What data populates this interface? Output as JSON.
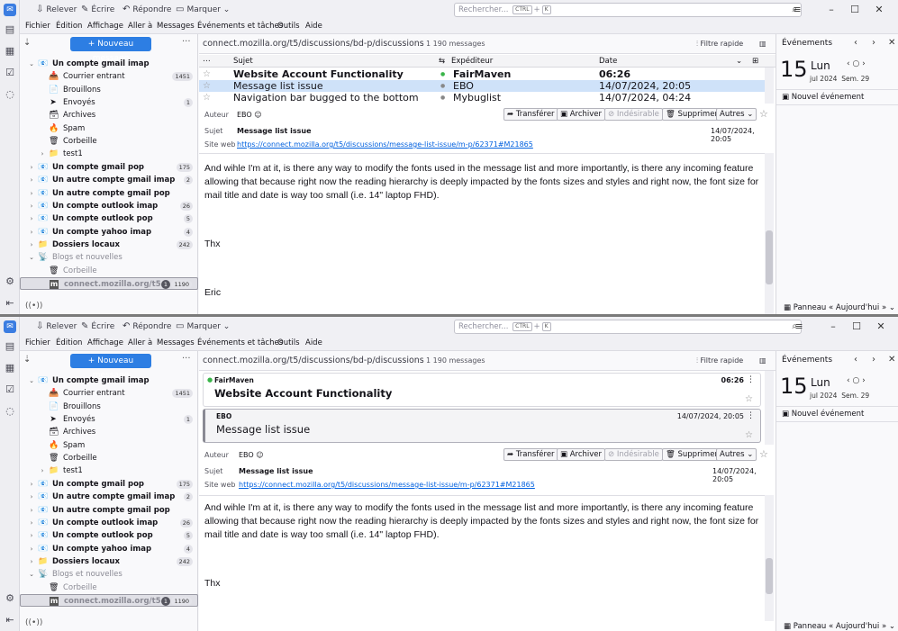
{
  "toolbar": {
    "get_mail": "Relever",
    "write": "Écrire",
    "reply": "Répondre",
    "tag": "Marquer",
    "search_placeholder": "Rechercher...",
    "kbd1": "CTRL",
    "kbd_plus": "+",
    "kbd2": "K"
  },
  "menu": [
    "Fichier",
    "Édition",
    "Affichage",
    "Aller à",
    "Messages",
    "Événements et tâches",
    "Outils",
    "Aide"
  ],
  "folders": {
    "new_message": "+ Nouveau message",
    "items": [
      {
        "label": "Un compte gmail imap",
        "bold": true,
        "level": 0,
        "icon": "📧",
        "badge": ""
      },
      {
        "label": "Courrier entrant",
        "bold": false,
        "level": 1,
        "icon": "📥",
        "badge": "1451"
      },
      {
        "label": "Brouillons",
        "bold": false,
        "level": 1,
        "icon": "📄",
        "badge": ""
      },
      {
        "label": "Envoyés",
        "bold": false,
        "level": 1,
        "icon": "➤",
        "badge": "1"
      },
      {
        "label": "Archives",
        "bold": false,
        "level": 1,
        "icon": "🗃",
        "badge": ""
      },
      {
        "label": "Spam",
        "bold": false,
        "level": 1,
        "icon": "🔥",
        "badge": ""
      },
      {
        "label": "Corbeille",
        "bold": false,
        "level": 1,
        "icon": "🗑",
        "badge": ""
      },
      {
        "label": "test1",
        "bold": false,
        "level": 1,
        "icon": "📁",
        "badge": ""
      },
      {
        "label": "Un compte gmail pop",
        "bold": true,
        "level": 0,
        "icon": "📧",
        "badge": "175"
      },
      {
        "label": "Un autre compte gmail imap",
        "bold": true,
        "level": 0,
        "icon": "📧",
        "badge": "2"
      },
      {
        "label": "Un autre compte gmail pop",
        "bold": true,
        "level": 0,
        "icon": "📧",
        "badge": ""
      },
      {
        "label": "Un compte outlook imap",
        "bold": true,
        "level": 0,
        "icon": "📧",
        "badge": "26"
      },
      {
        "label": "Un compte outlook pop",
        "bold": true,
        "level": 0,
        "icon": "📧",
        "badge": "5"
      },
      {
        "label": "Un compte yahoo imap",
        "bold": true,
        "level": 0,
        "icon": "📧",
        "badge": "4"
      },
      {
        "label": "Dossiers locaux",
        "bold": true,
        "level": 0,
        "icon": "📁",
        "badge": "242"
      },
      {
        "label": "Blogs et nouvelles",
        "bold": false,
        "level": 0,
        "icon": "📡",
        "badge": "",
        "grey": true
      },
      {
        "label": "Corbeille",
        "bold": false,
        "level": 1,
        "icon": "🗑",
        "badge": "",
        "grey": true
      },
      {
        "label": "connect.mozilla.org/t5...",
        "bold": true,
        "level": 1,
        "icon": "m",
        "badge": "1190",
        "unread": "1",
        "selected": true,
        "grey": true
      }
    ]
  },
  "list": {
    "path": "connect.mozilla.org/t5/discussions/bd-p/discussions",
    "count": "1 190 messages",
    "quick_filter": "Filtre rapide",
    "col_subject": "Sujet",
    "col_sender": "Expéditeur",
    "col_date": "Date",
    "rows": [
      {
        "subject": "Website Account Functionality",
        "sender": "FairMaven",
        "date": "06:26",
        "bold": true
      },
      {
        "subject": "Message list issue",
        "sender": "EBO",
        "date": "14/07/2024, 20:05",
        "bold": false,
        "selected": true
      },
      {
        "subject": "Navigation bar bugged to the bottom",
        "sender": "Mybuglist",
        "date": "14/07/2024, 04:24",
        "bold": false
      }
    ]
  },
  "header": {
    "author_label": "Auteur",
    "author": "EBO",
    "subject_label": "Sujet",
    "subject": "Message list issue",
    "site_label": "Site web",
    "site": "https://connect.mozilla.org/t5/discussions/message-list-issue/m-p/62371#M21865",
    "date": "14/07/2024, 20:05",
    "forward": "Transférer",
    "archive": "Archiver",
    "junk": "Indésirable",
    "delete": "Supprimer",
    "other": "Autres"
  },
  "body": {
    "p1": "And wihle I'm at it, is there any way to modify the fonts used in the message list and more importantly, is there any incoming feature allowing that because right now the reading hierarchy is deeply impacted by the fonts sizes and styles and right now, the font size for mail title and date is way too small (i.e. 14\" laptop FHD).",
    "p2": "Thx",
    "p3": "Eric"
  },
  "today": {
    "title": "Événements",
    "day": "15",
    "dow": "Lun",
    "month_year": "jul 2024",
    "week": "Sem. 29",
    "new_event": "Nouvel événement",
    "panel": "Panneau « Aujourd'hui »"
  },
  "cards": [
    {
      "sender": "FairMaven",
      "time": "06:26",
      "subject": "Website Account Functionality"
    },
    {
      "sender": "EBO",
      "time": "14/07/2024, 20:05",
      "subject": "Message list issue"
    }
  ]
}
